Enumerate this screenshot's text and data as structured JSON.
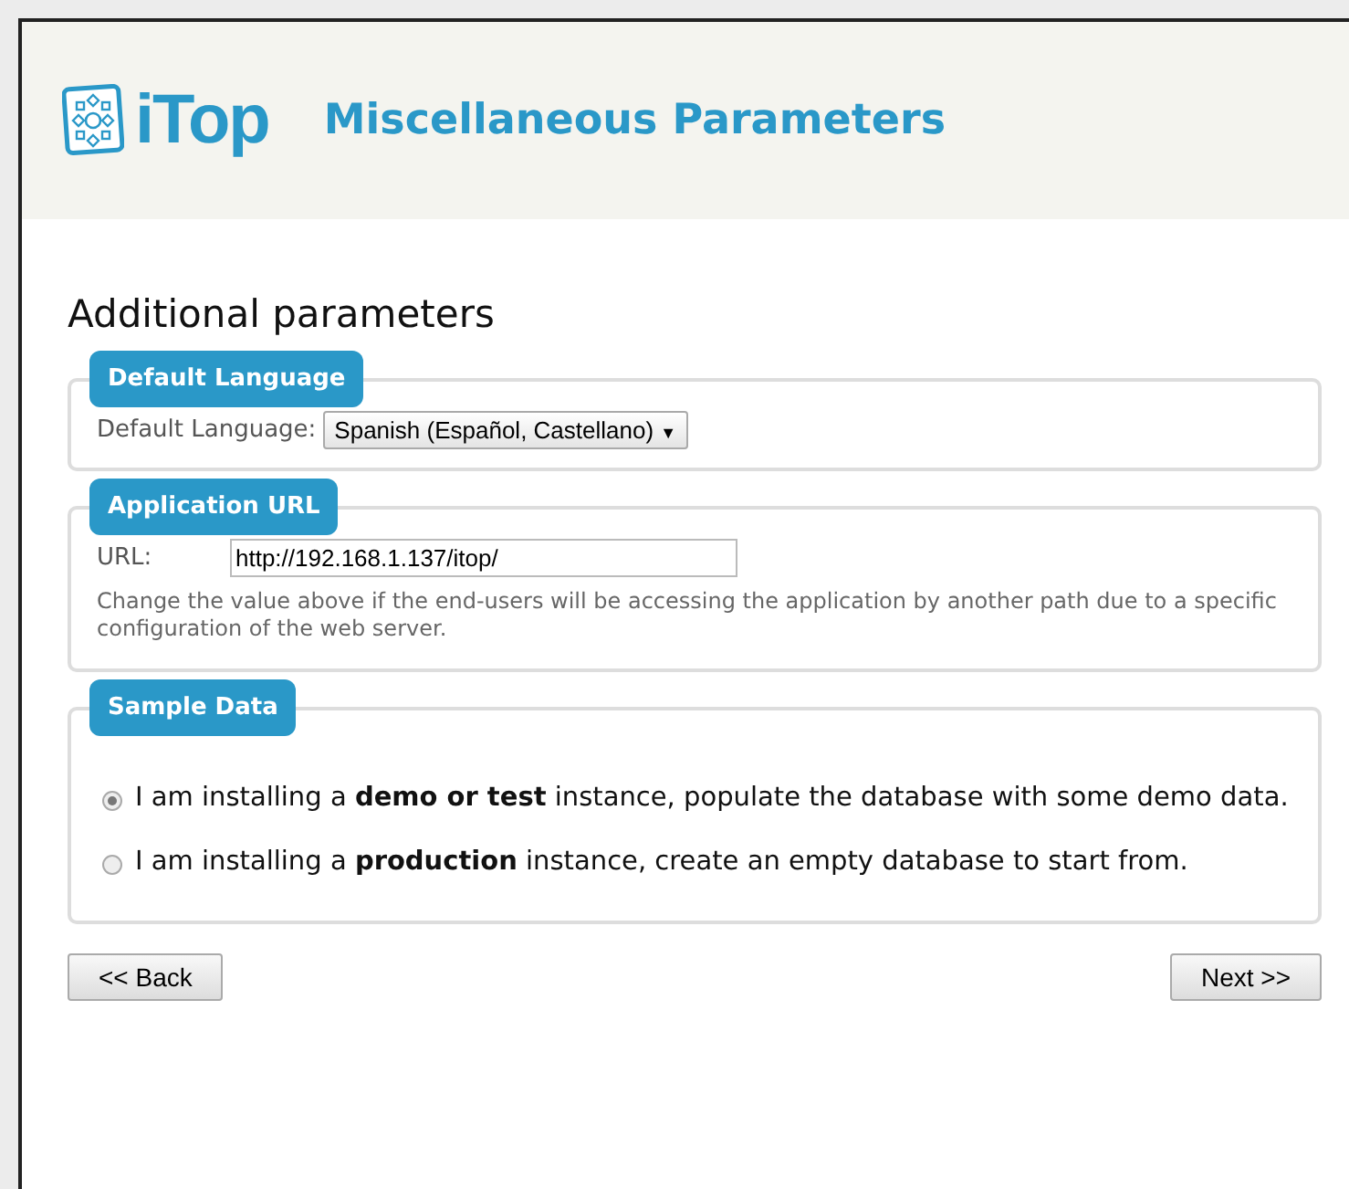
{
  "header": {
    "logo": "iTop",
    "title": "Miscellaneous Parameters"
  },
  "heading": "Additional parameters",
  "sections": [
    {
      "legend": "Default Language",
      "kind": "select",
      "label": "Default Language:",
      "value": "Spanish (Español, Castellano)",
      "arrow": "▼"
    },
    {
      "legend": "Application URL",
      "kind": "url",
      "label": "URL:",
      "value": "http://192.168.1.137/itop/",
      "help": "Change the value above if the end-users will be accessing the application by another path due to a specific configuration of the web server."
    },
    {
      "legend": "Sample Data",
      "kind": "radios",
      "options": [
        {
          "text": "I am installing a **demo or test** instance, populate the database with some demo data.",
          "selected": true
        },
        {
          "text": "I am installing a **production** instance, create an empty database to start from.",
          "selected": false
        }
      ]
    }
  ],
  "buttons": [
    {
      "label": "<< Back"
    },
    {
      "label": "Next >>"
    }
  ]
}
